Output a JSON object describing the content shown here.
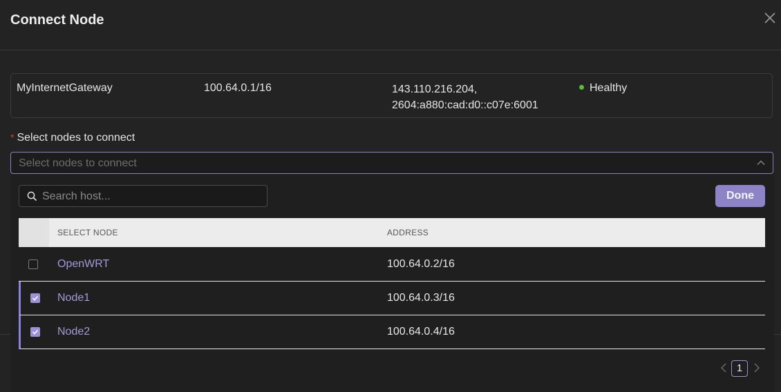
{
  "dialog": {
    "title": "Connect Node"
  },
  "gateway": {
    "name": "MyInternetGateway",
    "ip": "100.64.0.1/16",
    "public_ip_line1": "143.110.216.204,",
    "public_ip_line2": "2604:a880:cad:d0::c07e:6001",
    "status": "Healthy",
    "status_color": "#56c030"
  },
  "field": {
    "label": "Select nodes to connect",
    "placeholder": "Select nodes to connect"
  },
  "search": {
    "placeholder": "Search host..."
  },
  "done_label": "Done",
  "table": {
    "headers": {
      "node": "SELECT NODE",
      "address": "ADDRESS"
    },
    "rows": [
      {
        "name": "OpenWRT",
        "address": "100.64.0.2/16",
        "selected": false
      },
      {
        "name": "Node1",
        "address": "100.64.0.3/16",
        "selected": true
      },
      {
        "name": "Node2",
        "address": "100.64.0.4/16",
        "selected": true
      }
    ]
  },
  "pagination": {
    "current_page": "1"
  },
  "colors": {
    "accent": "#8c84c7",
    "link": "#a49ad8"
  }
}
